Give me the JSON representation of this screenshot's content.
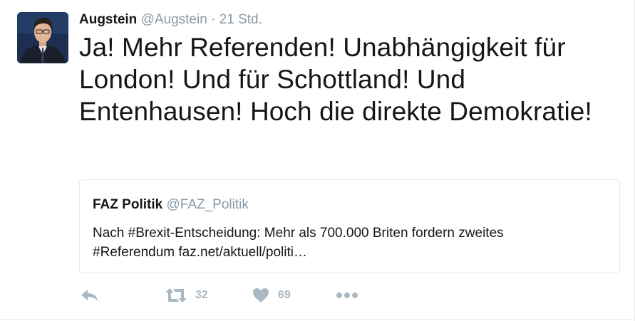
{
  "tweet": {
    "author_name": "Augstein",
    "author_handle": "@Augstein",
    "separator": "·",
    "time": "21 Std.",
    "text": "Ja! Mehr Referenden! Unabhängigkeit für London! Und für Schottland! Und Entenhausen! Hoch die direkte Demokratie!"
  },
  "quoted_tweet": {
    "author_name": "FAZ Politik",
    "author_handle": "@FAZ_Politik",
    "text_line1": "Nach #Brexit-Entscheidung: Mehr als 700.000 Briten fordern zweites",
    "text_line2": "#Referendum faz.net/aktuell/politi…"
  },
  "actions": {
    "reply_icon": "reply-icon",
    "retweet_icon": "retweet-icon",
    "retweet_count": "32",
    "like_icon": "heart-icon",
    "like_count": "69",
    "more_icon": "more-dots-icon"
  },
  "colors": {
    "text": "#14171a",
    "muted": "#8899a6",
    "action_grey": "#aab8c2",
    "border": "#e1e8ed"
  }
}
